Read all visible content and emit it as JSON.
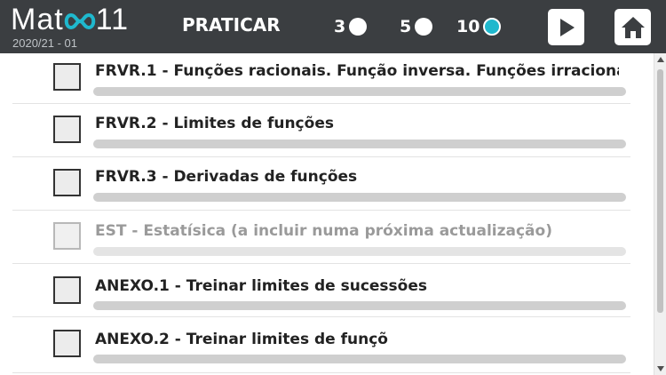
{
  "app": {
    "logo_left": "Mat",
    "logo_right": "11",
    "logo_mid_icon": "infinity-icon",
    "version": "2020/21 - 01"
  },
  "header": {
    "mode_title": "PRATICAR",
    "question_counts": [
      {
        "label": "3",
        "selected": false
      },
      {
        "label": "5",
        "selected": false
      },
      {
        "label": "10",
        "selected": true
      }
    ],
    "play_icon": "play-icon",
    "home_icon": "home-icon"
  },
  "topics": [
    {
      "label": "FRVR.1 - Funções racionais. Função inversa. Funções irracionai",
      "checked": false,
      "enabled": true,
      "progress": 0
    },
    {
      "label": "FRVR.2 - Limites de funções",
      "checked": false,
      "enabled": true,
      "progress": 0
    },
    {
      "label": "FRVR.3 - Derivadas de funções",
      "checked": false,
      "enabled": true,
      "progress": 0
    },
    {
      "label": "EST - Estatísica (a incluir numa próxima actualização)",
      "checked": false,
      "enabled": false,
      "progress": 0
    },
    {
      "label": "ANEXO.1 - Treinar limites de sucessões",
      "checked": false,
      "enabled": true,
      "progress": 0
    },
    {
      "label": "ANEXO.2 - Treinar limites de funções",
      "checked": false,
      "enabled": true,
      "progress": 0
    }
  ],
  "colors": {
    "header_bg": "#3b3e41",
    "accent": "#1fb8cd",
    "progress_track": "#cfcfcf"
  }
}
